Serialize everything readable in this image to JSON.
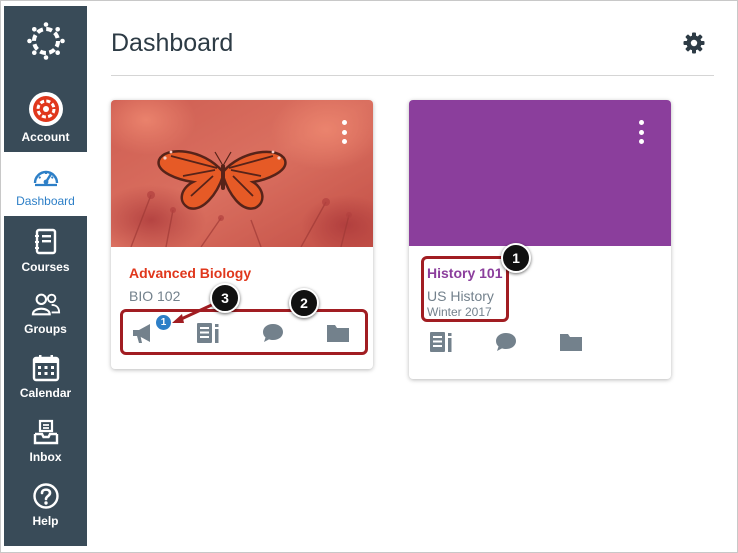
{
  "page": {
    "title": "Dashboard"
  },
  "sidebar": {
    "items": [
      {
        "label": "Account"
      },
      {
        "label": "Dashboard"
      },
      {
        "label": "Courses"
      },
      {
        "label": "Groups"
      },
      {
        "label": "Calendar"
      },
      {
        "label": "Inbox"
      },
      {
        "label": "Help"
      }
    ]
  },
  "courses": [
    {
      "title": "Advanced Biology",
      "code": "BIO 102",
      "term": "",
      "color": "#e0371c",
      "announcement_badge": "1",
      "icons": [
        "announcements-icon",
        "assignments-icon",
        "discussions-icon",
        "files-icon"
      ]
    },
    {
      "title": "History 101",
      "code": "US History",
      "term": "Winter 2017",
      "color": "#8b3e9c",
      "icons": [
        "assignments-icon",
        "discussions-icon",
        "files-icon"
      ]
    }
  ],
  "callouts": [
    "1",
    "2",
    "3"
  ],
  "colors": {
    "sidebar": "#394b58",
    "active_nav": "#2d7fc7",
    "icon_gray": "#73818c",
    "callout_red": "#a11d22",
    "history_purple": "#8b3e9c",
    "biology_red": "#e0371c"
  }
}
